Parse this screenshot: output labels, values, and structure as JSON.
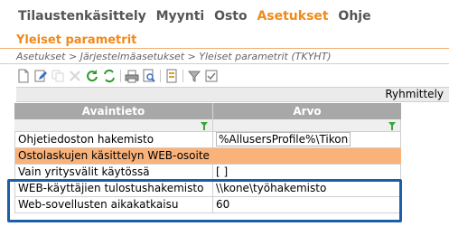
{
  "menu": {
    "items": [
      {
        "label": "Tilaustenkäsittely",
        "active": false
      },
      {
        "label": "Myynti",
        "active": false
      },
      {
        "label": "Osto",
        "active": false
      },
      {
        "label": "Asetukset",
        "active": true
      },
      {
        "label": "Ohje",
        "active": false
      }
    ]
  },
  "page": {
    "title": "Yleiset parametrit",
    "breadcrumb": "Asetukset > Järjestelmäasetukset > Yleiset parametrit  (TKYHT)"
  },
  "toolbar": {
    "icons": [
      "new-icon",
      "edit-icon",
      "copy-icon",
      "delete-icon",
      "refresh-icon",
      "sync-icon",
      "print-icon",
      "preview-icon",
      "export-icon",
      "filter-icon",
      "check-icon"
    ]
  },
  "grouping": {
    "label": "Ryhmittely"
  },
  "grid": {
    "columns": [
      "Avaintieto",
      "Arvo"
    ],
    "rows": [
      {
        "key": "Ohjetiedoston hakemisto",
        "value": "%AllusersProfile%\\Tikon",
        "selected": false,
        "boxed": true
      },
      {
        "key": "Ostolaskujen käsittelyn WEB-osoite",
        "value": "",
        "selected": true,
        "boxed": false
      },
      {
        "key": "Vain yritysvälit käytössä",
        "value": "[ ]",
        "selected": false,
        "boxed": false
      },
      {
        "key": "WEB-käyttäjien tulostushakemisto",
        "value": "\\\\kone\\työhakemisto",
        "selected": false,
        "boxed": false
      },
      {
        "key": "Web-sovellusten aikakatkaisu",
        "value": "60",
        "selected": false,
        "boxed": false
      }
    ]
  },
  "colors": {
    "accent": "#f08a1c",
    "selected_row": "#f8b27a",
    "header": "#a8a8a8",
    "highlight_frame": "#1a5fa8",
    "filter_icon": "#3aa637"
  }
}
